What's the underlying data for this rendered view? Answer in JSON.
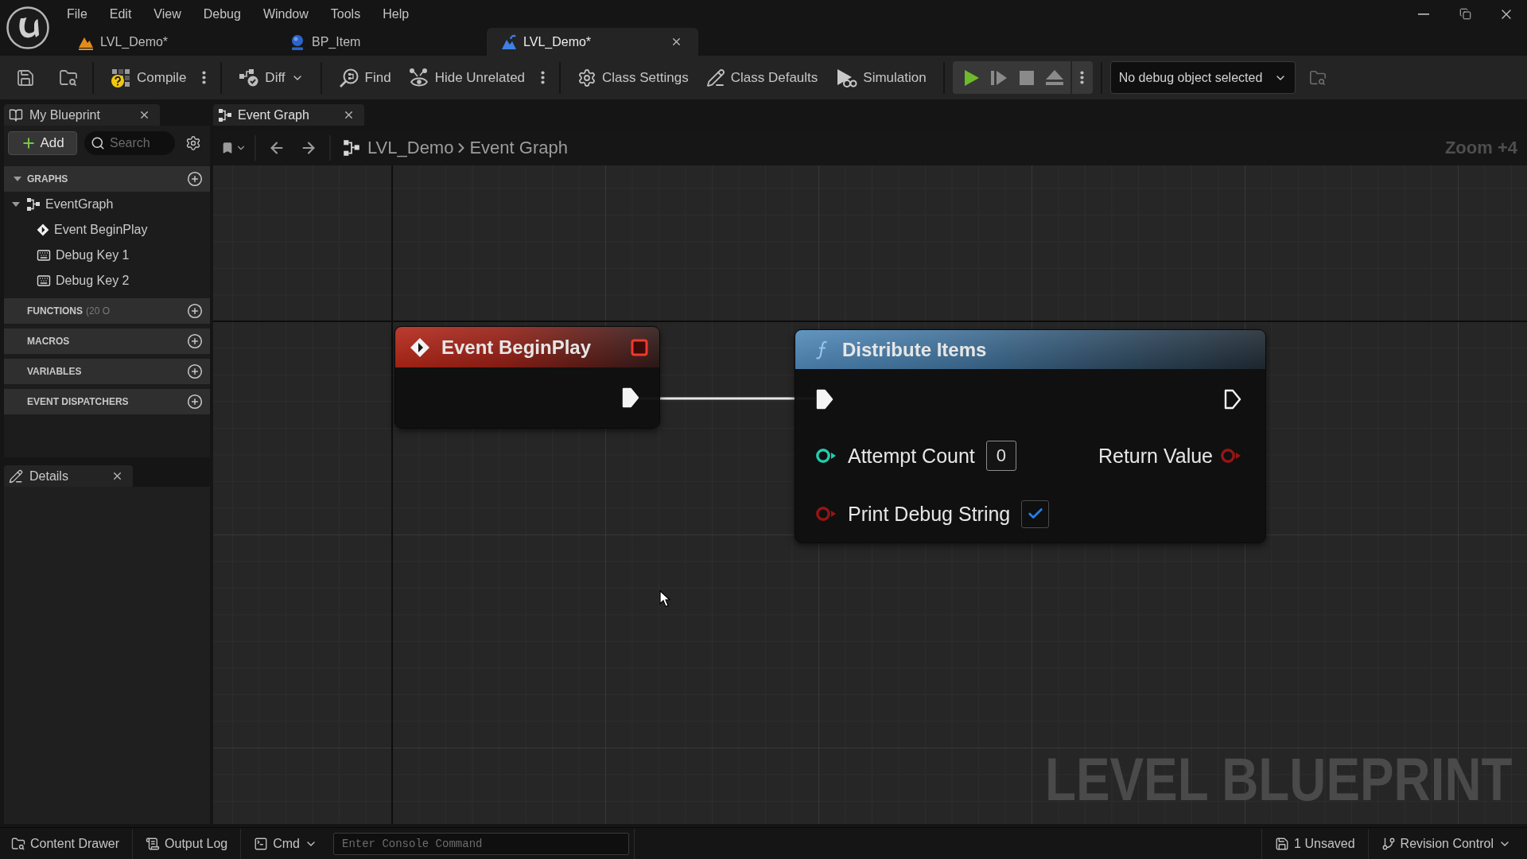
{
  "menu_bar": [
    "File",
    "Edit",
    "View",
    "Debug",
    "Window",
    "Tools",
    "Help"
  ],
  "document_tabs": [
    {
      "label": "LVL_Demo*",
      "kind": "level",
      "selected": false
    },
    {
      "label": "BP_Item",
      "kind": "blueprint",
      "selected": false
    },
    {
      "label": "LVL_Demo*",
      "kind": "level_blueprint",
      "selected": true
    }
  ],
  "toolbar": {
    "buttons": [
      {
        "label": "Compile",
        "kind": "compile"
      },
      {
        "label": "Diff",
        "kind": "diff"
      },
      {
        "label": "Find",
        "kind": "find"
      },
      {
        "label": "Hide Unrelated",
        "kind": "hide_unrelated"
      },
      {
        "label": "Class Settings",
        "kind": "class_settings"
      },
      {
        "label": "Class Defaults",
        "kind": "class_defaults"
      },
      {
        "label": "Simulation",
        "kind": "simulation"
      }
    ],
    "play_controls": [
      {
        "kind": "play",
        "disabled": false
      },
      {
        "kind": "advance",
        "disabled": true
      },
      {
        "kind": "stop",
        "disabled": true
      },
      {
        "kind": "eject",
        "disabled": true
      }
    ],
    "debug_object": "No debug object selected"
  },
  "my_blueprint": {
    "title": "My Blueprint",
    "add_label": "Add",
    "search_placeholder": "Search",
    "sections": [
      {
        "label": "GRAPHS",
        "expanded": true,
        "items": [
          {
            "label": "EventGraph",
            "kind": "graph",
            "expanded": true,
            "children": [
              {
                "label": "Event BeginPlay",
                "kind": "event"
              },
              {
                "label": "Debug Key 1",
                "kind": "key_event"
              },
              {
                "label": "Debug Key 2",
                "kind": "key_event"
              }
            ]
          }
        ]
      },
      {
        "label": "FUNCTIONS",
        "count": "(20 O"
      },
      {
        "label": "MACROS"
      },
      {
        "label": "VARIABLES"
      },
      {
        "label": "EVENT DISPATCHERS"
      }
    ]
  },
  "details_panel": {
    "title": "Details"
  },
  "graph_editor": {
    "tab": "Event Graph",
    "breadcrumb": [
      "LVL_Demo",
      "Event Graph"
    ],
    "zoom": "Zoom +4",
    "graph_type": "LEVEL BLUEPRINT",
    "nodes": [
      {
        "kind": "event",
        "title": "Event BeginPlay",
        "exec_out": {
          "connected": true
        }
      },
      {
        "kind": "function",
        "title": "Distribute Items",
        "exec_in": {
          "connected": true
        },
        "exec_out": {
          "connected": false
        },
        "inputs": [
          {
            "label": "Attempt Count",
            "kind": "integer",
            "value": "0"
          },
          {
            "label": "Print Debug String",
            "kind": "boolean",
            "checked": true
          }
        ],
        "outputs": [
          {
            "label": "Return Value",
            "kind": "boolean"
          }
        ]
      }
    ]
  },
  "status_bar": {
    "left": [
      {
        "label": "Content Drawer",
        "kind": "content_drawer"
      },
      {
        "label": "Output Log",
        "kind": "output_log"
      },
      {
        "label": "Cmd",
        "kind": "cmd"
      }
    ],
    "console_placeholder": "Enter Console Command",
    "right": [
      {
        "label": "1 Unsaved",
        "kind": "unsaved"
      },
      {
        "label": "Revision Control",
        "kind": "revision_control"
      }
    ]
  }
}
